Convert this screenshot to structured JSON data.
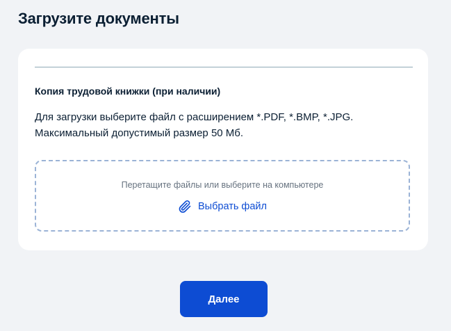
{
  "page": {
    "title": "Загрузите документы"
  },
  "upload_section": {
    "title": "Копия трудовой книжки (при наличии)",
    "description_line1": "Для загрузки выберите файл с расширением *.PDF, *.BMP, *.JPG.",
    "description_line2": "Максимальный допустимый размер 50 Мб.",
    "dropzone": {
      "hint": "Перетащите файлы или выберите на компьютере",
      "choose_file_label": "Выбрать файл",
      "icon": "paperclip-icon"
    }
  },
  "actions": {
    "next_label": "Далее"
  },
  "colors": {
    "accent": "#0d4cd3",
    "background": "#f1f3f6",
    "card": "#ffffff",
    "text": "#0b1f33",
    "muted_text": "#66727f",
    "dropzone_border": "#9bb3d6",
    "divider": "#8eaab5"
  }
}
